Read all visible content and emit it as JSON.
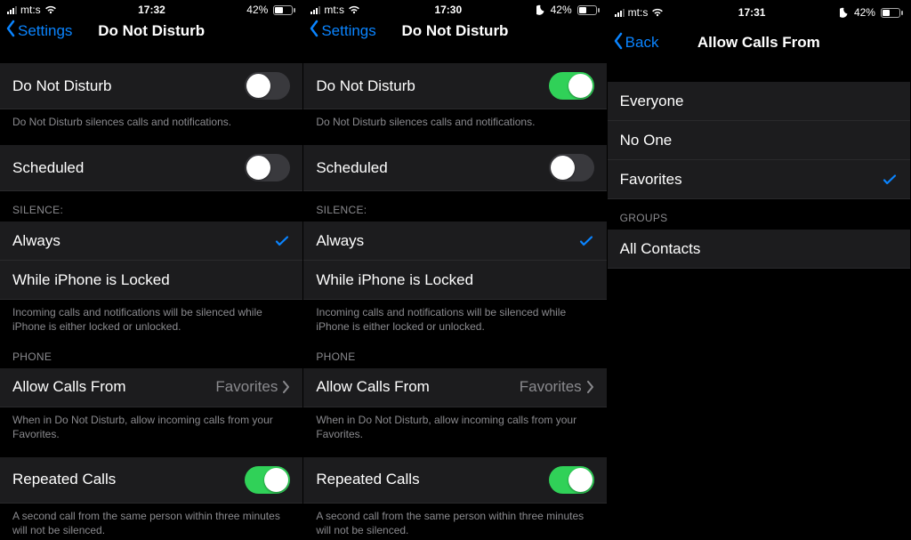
{
  "colors": {
    "accent": "#0a84ff",
    "green": "#30d158"
  },
  "panels": [
    {
      "status": {
        "carrier": "mt:s",
        "time": "17:32",
        "battery_pct": "42%",
        "battery_fill": 42,
        "show_moon": false
      },
      "nav": {
        "back": "Settings",
        "title": "Do Not Disturb"
      },
      "dnd_label": "Do Not Disturb",
      "dnd_on": false,
      "dnd_note": "Do Not Disturb silences calls and notifications.",
      "scheduled_label": "Scheduled",
      "scheduled_on": false,
      "silence_header": "SILENCE:",
      "silence_options": [
        "Always",
        "While iPhone is Locked"
      ],
      "silence_selected": 0,
      "silence_note": "Incoming calls and notifications will be silenced while iPhone is either locked or unlocked.",
      "phone_header": "PHONE",
      "allow_calls_label": "Allow Calls From",
      "allow_calls_value": "Favorites",
      "allow_calls_note": "When in Do Not Disturb, allow incoming calls from your Favorites.",
      "repeated_label": "Repeated Calls",
      "repeated_on": true,
      "repeated_note": "A second call from the same person within three minutes will not be silenced."
    },
    {
      "status": {
        "carrier": "mt:s",
        "time": "17:30",
        "battery_pct": "42%",
        "battery_fill": 42,
        "show_moon": true
      },
      "nav": {
        "back": "Settings",
        "title": "Do Not Disturb"
      },
      "dnd_label": "Do Not Disturb",
      "dnd_on": true,
      "dnd_note": "Do Not Disturb silences calls and notifications.",
      "scheduled_label": "Scheduled",
      "scheduled_on": false,
      "silence_header": "SILENCE:",
      "silence_options": [
        "Always",
        "While iPhone is Locked"
      ],
      "silence_selected": 0,
      "silence_note": "Incoming calls and notifications will be silenced while iPhone is either locked or unlocked.",
      "phone_header": "PHONE",
      "allow_calls_label": "Allow Calls From",
      "allow_calls_value": "Favorites",
      "allow_calls_note": "When in Do Not Disturb, allow incoming calls from your Favorites.",
      "repeated_label": "Repeated Calls",
      "repeated_on": true,
      "repeated_note": "A second call from the same person within three minutes will not be silenced."
    },
    {
      "status": {
        "carrier": "mt:s",
        "time": "17:31",
        "battery_pct": "42%",
        "battery_fill": 42,
        "show_moon": true
      },
      "nav": {
        "back": "Back",
        "title": "Allow Calls From"
      },
      "options": [
        "Everyone",
        "No One",
        "Favorites"
      ],
      "selected": 2,
      "groups_header": "GROUPS",
      "groups": [
        "All Contacts"
      ]
    }
  ]
}
